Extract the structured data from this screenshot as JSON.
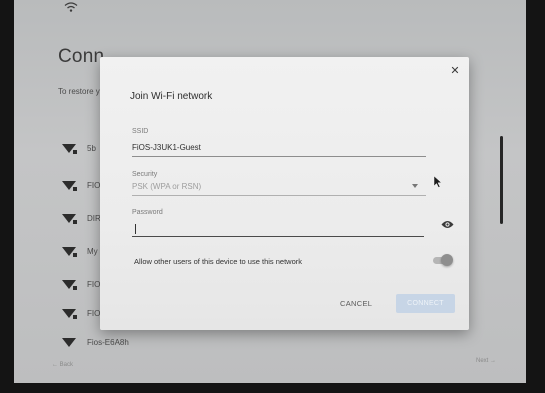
{
  "background": {
    "title": "Conn",
    "subtitle": "To restore y",
    "networks": [
      {
        "name": "5b"
      },
      {
        "name": "FIO"
      },
      {
        "name": "DIR"
      },
      {
        "name": "My"
      },
      {
        "name": "FIO"
      },
      {
        "name": "FIO"
      },
      {
        "name": "Fios-E6A8h"
      }
    ],
    "back_label": "← Back",
    "next_label": "Next →"
  },
  "dialog": {
    "close_icon": "close-icon",
    "title": "Join Wi-Fi network",
    "ssid": {
      "label": "SSID",
      "value": "FiOS-J3UK1-Guest"
    },
    "security": {
      "label": "Security",
      "value": "PSK (WPA or RSN)"
    },
    "password": {
      "label": "Password",
      "value": ""
    },
    "allow_text": "Allow other users of this device to use this network",
    "allow_toggle_on": true,
    "cancel_label": "CANCEL",
    "connect_label": "CONNECT"
  },
  "colors": {
    "connect_button": "#c7d5e6",
    "dialog_bg": "#efefef",
    "screen_bg": "#bfc0c1"
  }
}
